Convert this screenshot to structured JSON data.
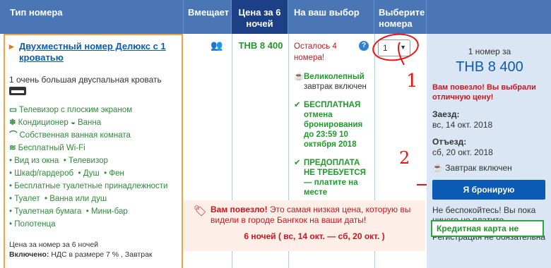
{
  "header": {
    "room_type": "Тип номера",
    "sleeps": "Вмещает",
    "price_for": "Цена за 6 ночей",
    "your_choice": "На ваш выбор",
    "select_rooms": "Выберите номера"
  },
  "room": {
    "name": "Двухместный номер Делюкс с 1 кроватью",
    "bed": "1 очень большая двуспальная кровать",
    "amenities_icons": [
      {
        "icon": "tv-icon",
        "label": "Телевизор с плоским экраном"
      },
      {
        "icon": "snowflake-icon",
        "label": "Кондиционер"
      },
      {
        "icon": "bath-icon",
        "label": "Ванна"
      },
      {
        "icon": "shower-icon",
        "label": "Собственная ванная комната"
      },
      {
        "icon": "wifi-icon",
        "label": "Бесплатный Wi-Fi"
      }
    ],
    "amenities_list": [
      [
        "Вид из окна",
        "Телевизор"
      ],
      [
        "Шкаф/гардероб",
        "Душ",
        "Фен"
      ],
      [
        "Бесплатные туалетные принадлежности"
      ],
      [
        "Туалет",
        "Ванна или душ"
      ],
      [
        "Туалетная бумага",
        "Мини-бар"
      ],
      [
        "Полотенца"
      ]
    ],
    "price_note": "Цена за номер за 6 ночей",
    "included_label": "Включено:",
    "included_text": "НДС в размере 7 % , Завтрак"
  },
  "price": "THB 8 400",
  "choice": {
    "left": "Осталось 4 номера!",
    "help": "?",
    "breakfast_bold": "Великолепный",
    "breakfast_text": "завтрак включен",
    "free_cancel": "БЕСПЛАТНАЯ отмена бронирования до 23:59 10 октября 2018",
    "no_prepay": "ПРЕДОПЛАТА НЕ ТРЕБУЕТСЯ",
    "pay_there": "— платите на месте"
  },
  "select": {
    "value": "1"
  },
  "annotations": {
    "one": "1",
    "two": "2"
  },
  "side": {
    "count": "1 номер за",
    "total": "THB 8 400",
    "lucky": "Вам повезло! Вы выбрали отличную цену!",
    "checkin_label": "Заезд:",
    "checkin": "вс, 14 окт. 2018",
    "checkout_label": "Отъезд:",
    "checkout": "сб, 20 окт. 2018",
    "breakfast": "Завтрак включен",
    "book": "Я бронирую",
    "worry": "Не беспокойтесь! Вы пока ничего не платите.",
    "registration": "Регистрация не обязательна",
    "credit_card": "Кредитная карта не"
  },
  "banner": {
    "lucky": "Вам повезло!",
    "text": "Это самая низкая цена, которую вы видели в городе Бангкок на ваши даты!",
    "dates": "6 ночей ( вс, 14 окт. — сб, 20 окт. )"
  },
  "colors": {
    "header": "#4a76b5",
    "header_dark": "#1c3f86",
    "accent_green": "#1e9b2b",
    "accent_red": "#d0141d",
    "book_blue": "#0b5bb5"
  }
}
